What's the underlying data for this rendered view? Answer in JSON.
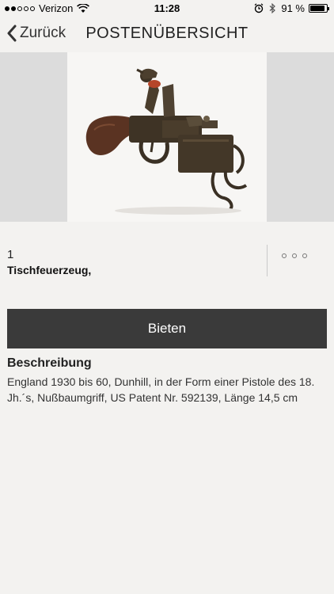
{
  "status_bar": {
    "carrier": "Verizon",
    "time": "11:28",
    "battery": "91 %",
    "battery_level": 0.91,
    "signal_bars": 2,
    "icons": [
      "signal-icon",
      "wifi-icon",
      "alarm-icon",
      "bluetooth-icon",
      "battery-icon"
    ]
  },
  "nav": {
    "back_label": "Zurück",
    "title": "POSTENÜBERSICHT"
  },
  "lot": {
    "number": "1",
    "title": "Tischfeuerzeug,"
  },
  "bid_label": "Bieten",
  "description": {
    "heading": "Beschreibung",
    "text": "England 1930 bis 60, Dunhill, in der Form einer Pistole des 18. Jh.´s, Nußbaumgriff, US Patent Nr. 592139, Länge 14,5 cm"
  },
  "colors": {
    "background": "#f3f2f0",
    "bid_button": "#3a3a3a",
    "gallery_side": "#dcdcdc"
  }
}
